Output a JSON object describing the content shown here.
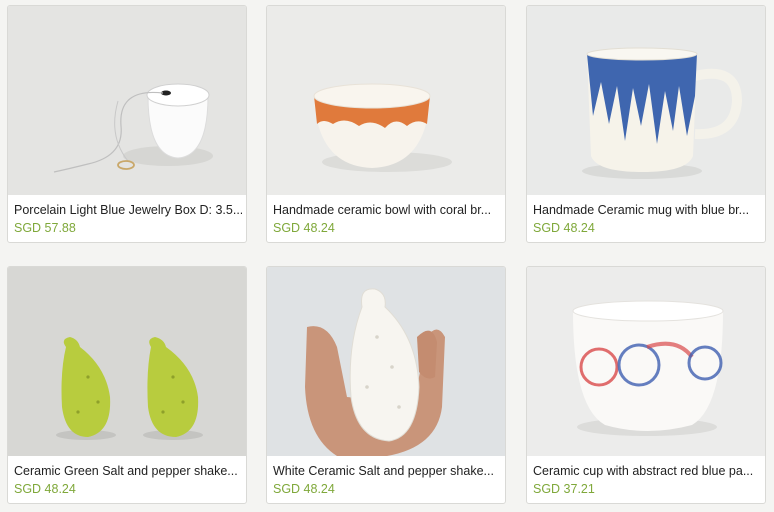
{
  "products": [
    {
      "title": "Porcelain Light Blue Jewelry Box D: 3.5...",
      "price": "SGD 57.88",
      "image": "white-porcelain-jewelry-box-with-necklace"
    },
    {
      "title": "Handmade ceramic bowl with coral br...",
      "price": "SGD 48.24",
      "image": "white-bowl-coral-brush-stroke"
    },
    {
      "title": "Handmade Ceramic mug with blue br...",
      "price": "SGD 48.24",
      "image": "white-mug-blue-brush-stroke"
    },
    {
      "title": "Ceramic Green Salt and pepper shake...",
      "price": "SGD 48.24",
      "image": "green-cactus-fruit-shakers"
    },
    {
      "title": "White Ceramic Salt and pepper shake...",
      "price": "SGD 48.24",
      "image": "hand-holding-white-cactus-fruit-shaker"
    },
    {
      "title": "Ceramic cup with abstract red blue pa...",
      "price": "SGD 37.21",
      "image": "white-cup-red-blue-circles"
    }
  ],
  "colors": {
    "price": "#7fa83a",
    "title": "#222222",
    "card_border": "#d9d9d6"
  }
}
